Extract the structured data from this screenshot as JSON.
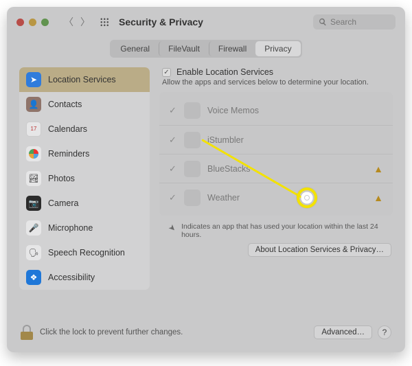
{
  "header": {
    "title": "Security & Privacy",
    "search_placeholder": "Search"
  },
  "tabs": [
    {
      "label": "General",
      "active": false
    },
    {
      "label": "FileVault",
      "active": false
    },
    {
      "label": "Firewall",
      "active": false
    },
    {
      "label": "Privacy",
      "active": true
    }
  ],
  "sidebar": {
    "items": [
      {
        "label": "Location Services",
        "icon": "ic-loc",
        "glyph": "➤",
        "selected": true
      },
      {
        "label": "Contacts",
        "icon": "ic-con",
        "glyph": "👤",
        "selected": false
      },
      {
        "label": "Calendars",
        "icon": "ic-cal",
        "glyph": "17",
        "selected": false
      },
      {
        "label": "Reminders",
        "icon": "ic-rem",
        "glyph": "",
        "selected": false
      },
      {
        "label": "Photos",
        "icon": "ic-pho",
        "glyph": "🏞",
        "selected": false
      },
      {
        "label": "Camera",
        "icon": "ic-cam",
        "glyph": "📷",
        "selected": false
      },
      {
        "label": "Microphone",
        "icon": "ic-mic",
        "glyph": "🎤",
        "selected": false
      },
      {
        "label": "Speech Recognition",
        "icon": "ic-spe",
        "glyph": "🗣",
        "selected": false
      },
      {
        "label": "Accessibility",
        "icon": "ic-acc",
        "glyph": "❖",
        "selected": false
      }
    ]
  },
  "panel": {
    "enable_label": "Enable Location Services",
    "enable_checked": true,
    "description": "Allow the apps and services below to determine your location.",
    "apps": [
      {
        "name": "Voice Memos",
        "checked": true,
        "warning": false
      },
      {
        "name": "iStumbler",
        "checked": true,
        "warning": false
      },
      {
        "name": "BlueStacks",
        "checked": true,
        "warning": true
      },
      {
        "name": "Weather",
        "checked": true,
        "warning": true
      }
    ],
    "indicator_text": "Indicates an app that has used your location within the last 24 hours.",
    "about_button": "About Location Services & Privacy…"
  },
  "footer": {
    "lock_text": "Click the lock to prevent further changes.",
    "advanced_button": "Advanced…",
    "help_glyph": "?"
  },
  "annotation": {
    "highlight_target": "BlueStacks checkbox"
  }
}
